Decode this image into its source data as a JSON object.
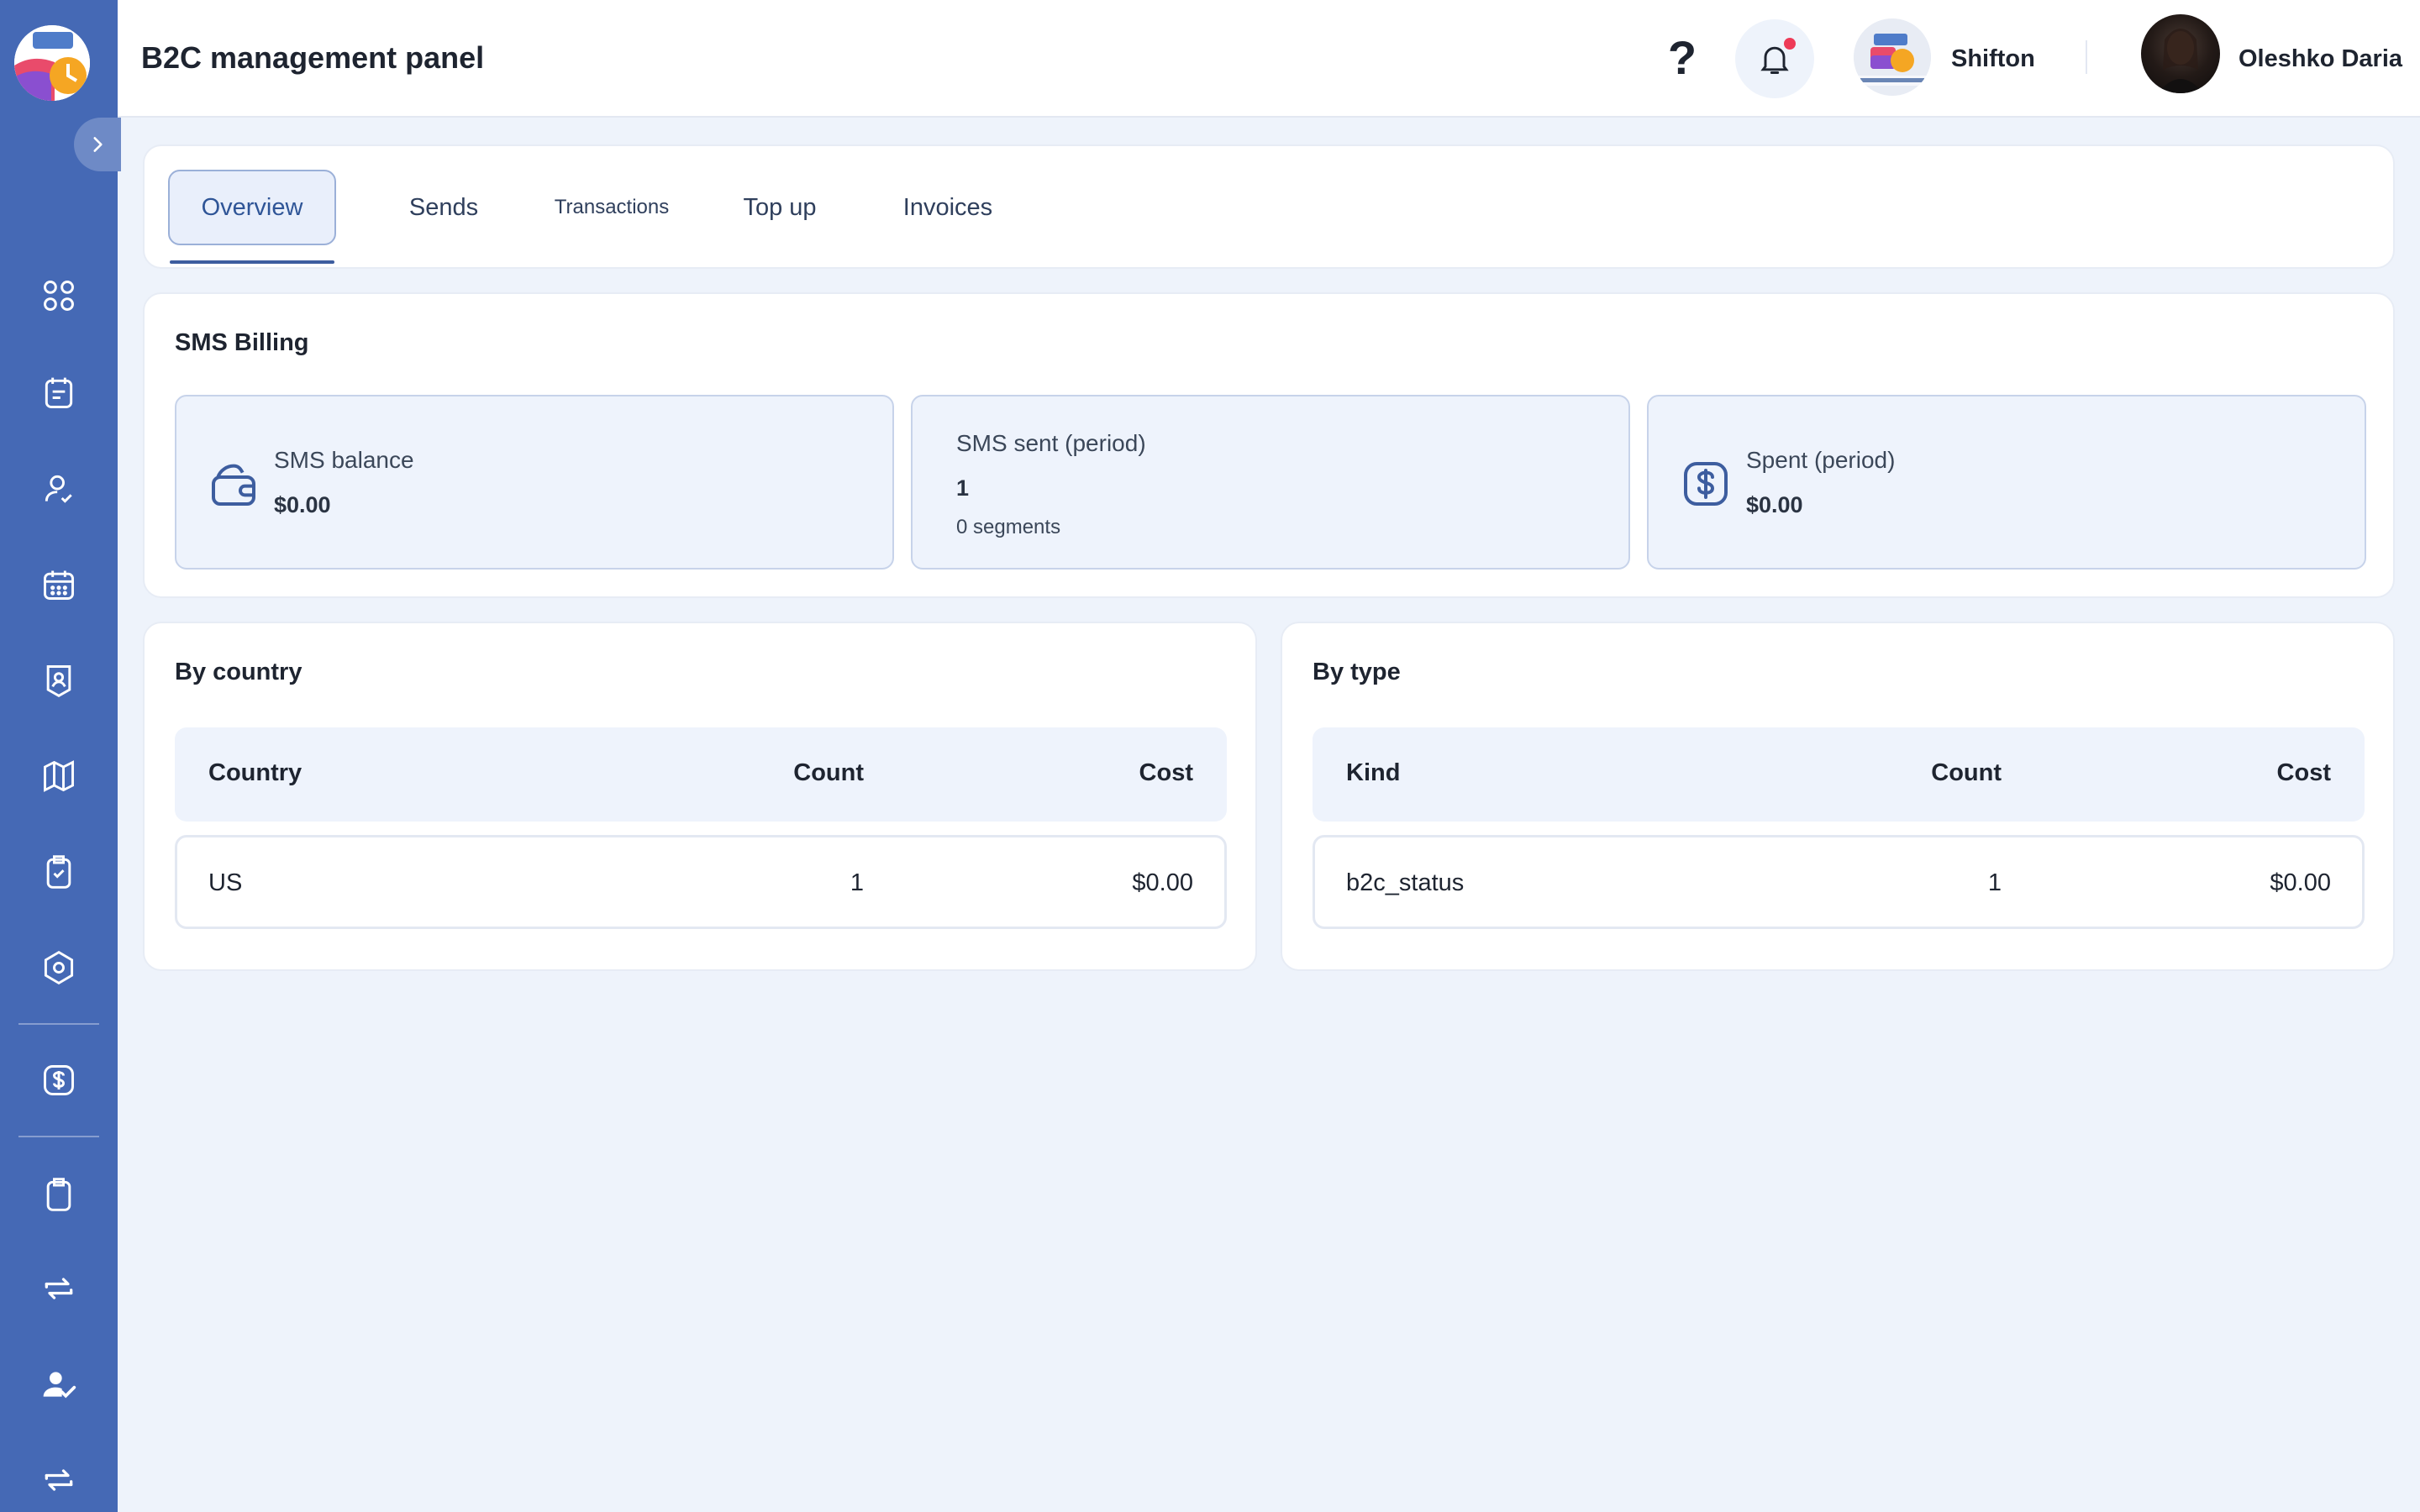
{
  "header": {
    "title": "B2C management panel",
    "help_label": "?",
    "company_name": "Shifton",
    "user_name": "Oleshko Daria"
  },
  "sidebar": {
    "items": [
      {
        "icon": "dashboard-icon"
      },
      {
        "icon": "schedule-list-icon"
      },
      {
        "icon": "user-check-icon"
      },
      {
        "icon": "calendar-icon"
      },
      {
        "icon": "badge-icon"
      },
      {
        "icon": "map-icon"
      },
      {
        "icon": "clipboard-check-icon"
      },
      {
        "icon": "settings-icon"
      },
      {
        "icon": "billing-dollar-icon"
      },
      {
        "icon": "clipboard-icon"
      },
      {
        "icon": "swap-icon"
      },
      {
        "icon": "user-verified-icon"
      },
      {
        "icon": "swap-icon"
      }
    ]
  },
  "tabs": [
    {
      "label": "Overview",
      "active": true
    },
    {
      "label": "Sends",
      "active": false
    },
    {
      "label": "Transactions",
      "active": false
    },
    {
      "label": "Top up",
      "active": false
    },
    {
      "label": "Invoices",
      "active": false
    }
  ],
  "billing": {
    "title": "SMS Billing",
    "balance": {
      "label": "SMS balance",
      "value": "$0.00"
    },
    "sent": {
      "label": "SMS sent (period)",
      "value": "1",
      "sub": "0 segments"
    },
    "spent": {
      "label": "Spent (period)",
      "value": "$0.00"
    }
  },
  "by_country": {
    "title": "By country",
    "columns": [
      "Country",
      "Count",
      "Cost"
    ],
    "rows": [
      [
        "US",
        "1",
        "$0.00"
      ]
    ]
  },
  "by_type": {
    "title": "By type",
    "columns": [
      "Kind",
      "Count",
      "Cost"
    ],
    "rows": [
      [
        "b2c_status",
        "1",
        "$0.00"
      ]
    ]
  },
  "colors": {
    "sidebar": "#4569b5",
    "accent": "#2f5597",
    "background": "#eef3fb",
    "notification_dot": "#ee3a57"
  }
}
